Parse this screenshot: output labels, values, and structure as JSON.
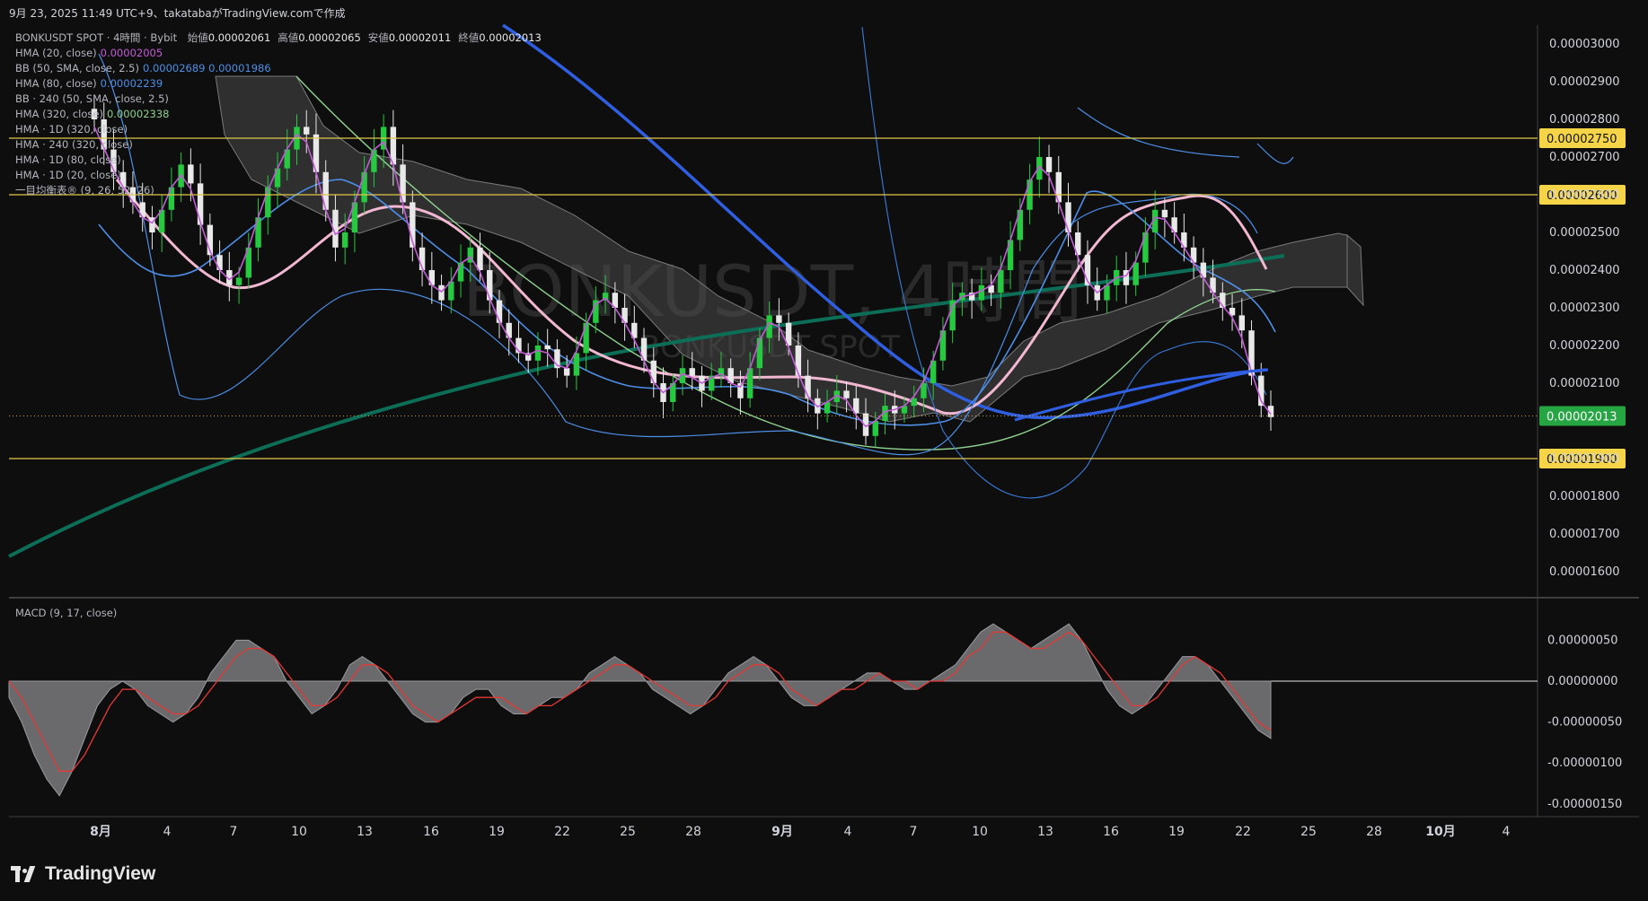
{
  "header": {
    "created": "9月 23, 2025 11:49 UTC+9、takatabaがTradingView.comで作成"
  },
  "legend": {
    "main": "BONKUSDT SPOT · 4時間 · Bybit",
    "ohlc": [
      {
        "label": "始値",
        "value": "0.00002061"
      },
      {
        "label": "高値",
        "value": "0.00002065"
      },
      {
        "label": "安値",
        "value": "0.00002011"
      },
      {
        "label": "終値",
        "value": "0.00002013"
      }
    ],
    "indicators": [
      {
        "label": "HMA (20, close)",
        "value": "0.00002005",
        "color": "#c15bd6"
      },
      {
        "label": "BB (50, SMA, close, 2.5)",
        "value": "0.00002689  0.00001986",
        "color": "#4d8ee6"
      },
      {
        "label": "HMA (80, close)",
        "value": "0.00002239",
        "color": "#4d8ee6"
      },
      {
        "label": "BB · 240 (50, SMA, close, 2.5)",
        "value": "",
        "color": "#b2b5be"
      },
      {
        "label": "HMA (320, close)",
        "value": "0.00002338",
        "color": "#8fd18f"
      },
      {
        "label": "HMA · 1D (320, close)",
        "value": "",
        "color": "#b2b5be"
      },
      {
        "label": "HMA · 240 (320, close)",
        "value": "",
        "color": "#b2b5be"
      },
      {
        "label": "HMA · 1D (80, close)",
        "value": "",
        "color": "#b2b5be"
      },
      {
        "label": "HMA · 1D (20, close)",
        "value": "",
        "color": "#b2b5be"
      },
      {
        "label": "一目均衡表® (9, 26, 52, 26)",
        "value": "",
        "color": "#b2b5be"
      }
    ]
  },
  "watermark": {
    "line1": "BONKUSDT, 4時間",
    "line2": "BONKUSDT SPOT"
  },
  "macd": {
    "title": "MACD (9, 17, close)"
  },
  "brand": {
    "name": "TradingView"
  },
  "colors": {
    "up": "#26c940",
    "down": "#e8e8e8",
    "hline": "#e3c84a",
    "price_tag": "#26a643"
  },
  "chart_data": [
    {
      "type": "candlestick",
      "title": "BONKUSDT SPOT · 4時間 · Bybit",
      "ylim": [
        1.55e-05,
        3.05e-05
      ],
      "y_ticks": [
        "0.00003000",
        "0.00002900",
        "0.00002800",
        "0.00002700",
        "0.00002600",
        "0.00002500",
        "0.00002400",
        "0.00002300",
        "0.00002200",
        "0.00002100",
        "0.00001900",
        "0.00001800",
        "0.00001700",
        "0.00001600"
      ],
      "x_ticks": [
        "8月",
        "4",
        "7",
        "10",
        "13",
        "16",
        "19",
        "22",
        "25",
        "28",
        "9月",
        "4",
        "7",
        "10",
        "13",
        "16",
        "19",
        "22",
        "25",
        "28",
        "10月",
        "4"
      ],
      "horizontal_levels": [
        {
          "value": 2.75e-05,
          "label": "0.00002750"
        },
        {
          "value": 2.6e-05,
          "label": "0.00002600"
        },
        {
          "value": 1.9e-05,
          "label": "0.00001900"
        }
      ],
      "last_price": {
        "value": 2.013e-05,
        "label": "0.00002013"
      },
      "close_series": [
        2.8e-05,
        2.72e-05,
        2.66e-05,
        2.62e-05,
        2.58e-05,
        2.54e-05,
        2.5e-05,
        2.56e-05,
        2.62e-05,
        2.68e-05,
        2.63e-05,
        2.52e-05,
        2.44e-05,
        2.4e-05,
        2.36e-05,
        2.38e-05,
        2.46e-05,
        2.54e-05,
        2.62e-05,
        2.67e-05,
        2.72e-05,
        2.78e-05,
        2.76e-05,
        2.66e-05,
        2.56e-05,
        2.46e-05,
        2.5e-05,
        2.58e-05,
        2.66e-05,
        2.72e-05,
        2.78e-05,
        2.68e-05,
        2.58e-05,
        2.46e-05,
        2.4e-05,
        2.36e-05,
        2.32e-05,
        2.37e-05,
        2.42e-05,
        2.46e-05,
        2.4e-05,
        2.32e-05,
        2.26e-05,
        2.22e-05,
        2.18e-05,
        2.16e-05,
        2.2e-05,
        2.19e-05,
        2.14e-05,
        2.12e-05,
        2.18e-05,
        2.26e-05,
        2.32e-05,
        2.34e-05,
        2.3e-05,
        2.26e-05,
        2.22e-05,
        2.16e-05,
        2.1e-05,
        2.05e-05,
        2.1e-05,
        2.14e-05,
        2.12e-05,
        2.08e-05,
        2.12e-05,
        2.14e-05,
        2.1e-05,
        2.06e-05,
        2.14e-05,
        2.22e-05,
        2.28e-05,
        2.26e-05,
        2.2e-05,
        2.12e-05,
        2.06e-05,
        2.02e-05,
        2.05e-05,
        2.08e-05,
        2.06e-05,
        2.02e-05,
        1.96e-05,
        2e-05,
        2.04e-05,
        2.02e-05,
        2.04e-05,
        2.06e-05,
        2.1e-05,
        2.16e-05,
        2.24e-05,
        2.32e-05,
        2.34e-05,
        2.32e-05,
        2.36e-05,
        2.34e-05,
        2.4e-05,
        2.48e-05,
        2.56e-05,
        2.64e-05,
        2.7e-05,
        2.66e-05,
        2.58e-05,
        2.5e-05,
        2.44e-05,
        2.36e-05,
        2.32e-05,
        2.36e-05,
        2.4e-05,
        2.36e-05,
        2.42e-05,
        2.5e-05,
        2.56e-05,
        2.54e-05,
        2.5e-05,
        2.46e-05,
        2.42e-05,
        2.38e-05,
        2.34e-05,
        2.3e-05,
        2.28e-05,
        2.24e-05,
        2.12e-05,
        2.04e-05,
        2.01e-05
      ]
    },
    {
      "type": "area",
      "title": "MACD (9, 17, close)",
      "ylim": [
        -1.6e-06,
        7e-07
      ],
      "y_ticks": [
        "0.00000050",
        "0.00000000",
        "-0.00000050",
        "-0.00000100",
        "-0.00000150"
      ],
      "series": [
        {
          "name": "MACD",
          "values": [
            -2e-07,
            -5e-07,
            -9e-07,
            -1.2e-06,
            -1.4e-06,
            -1.1e-06,
            -7e-07,
            -3e-07,
            -1e-07,
            0.0,
            -1e-07,
            -3e-07,
            -4e-07,
            -5e-07,
            -4e-07,
            -2e-07,
            1e-07,
            3e-07,
            5e-07,
            5e-07,
            4e-07,
            3e-07,
            0.0,
            -2e-07,
            -4e-07,
            -3e-07,
            -1e-07,
            2e-07,
            3e-07,
            2e-07,
            0.0,
            -2e-07,
            -4e-07,
            -5e-07,
            -5e-07,
            -4e-07,
            -2e-07,
            -1e-07,
            -1e-07,
            -3e-07,
            -4e-07,
            -4e-07,
            -3e-07,
            -2e-07,
            -2e-07,
            -1e-07,
            1e-07,
            2e-07,
            3e-07,
            2e-07,
            1e-07,
            -1e-07,
            -2e-07,
            -3e-07,
            -4e-07,
            -3e-07,
            -1e-07,
            1e-07,
            2e-07,
            3e-07,
            2e-07,
            0.0,
            -2e-07,
            -3e-07,
            -3e-07,
            -2e-07,
            -1e-07,
            0.0,
            1e-07,
            1e-07,
            0.0,
            -1e-07,
            -1e-07,
            0.0,
            1e-07,
            2e-07,
            4e-07,
            6e-07,
            7e-07,
            6e-07,
            5e-07,
            4e-07,
            5e-07,
            6e-07,
            7e-07,
            5e-07,
            2e-07,
            -1e-07,
            -3e-07,
            -4e-07,
            -3e-07,
            -1e-07,
            1e-07,
            3e-07,
            3e-07,
            2e-07,
            0.0,
            -2e-07,
            -4e-07,
            -6e-07,
            -7e-07
          ]
        },
        {
          "name": "Signal",
          "values": [
            0.0,
            -2e-07,
            -5e-07,
            -8e-07,
            -1.1e-06,
            -1.1e-06,
            -9e-07,
            -6e-07,
            -3e-07,
            -1e-07,
            -1e-07,
            -2e-07,
            -3e-07,
            -4e-07,
            -4e-07,
            -3e-07,
            -1e-07,
            1e-07,
            3e-07,
            4e-07,
            4e-07,
            3e-07,
            1e-07,
            -1e-07,
            -3e-07,
            -3e-07,
            -2e-07,
            0.0,
            2e-07,
            2e-07,
            1e-07,
            -1e-07,
            -3e-07,
            -4e-07,
            -5e-07,
            -4e-07,
            -3e-07,
            -2e-07,
            -2e-07,
            -2e-07,
            -3e-07,
            -4e-07,
            -3e-07,
            -3e-07,
            -2e-07,
            -1e-07,
            0.0,
            1e-07,
            2e-07,
            2e-07,
            1e-07,
            0.0,
            -1e-07,
            -2e-07,
            -3e-07,
            -3e-07,
            -2e-07,
            0.0,
            1e-07,
            2e-07,
            2e-07,
            1e-07,
            -1e-07,
            -2e-07,
            -3e-07,
            -2e-07,
            -1e-07,
            -1e-07,
            0.0,
            1e-07,
            0.0,
            0.0,
            -1e-07,
            0.0,
            0.0,
            1e-07,
            3e-07,
            4e-07,
            6e-07,
            6e-07,
            5e-07,
            4e-07,
            4e-07,
            5e-07,
            6e-07,
            5e-07,
            3e-07,
            1e-07,
            -1e-07,
            -3e-07,
            -3e-07,
            -2e-07,
            0.0,
            2e-07,
            3e-07,
            2e-07,
            1e-07,
            -1e-07,
            -3e-07,
            -5e-07,
            -6e-07
          ]
        }
      ]
    }
  ]
}
